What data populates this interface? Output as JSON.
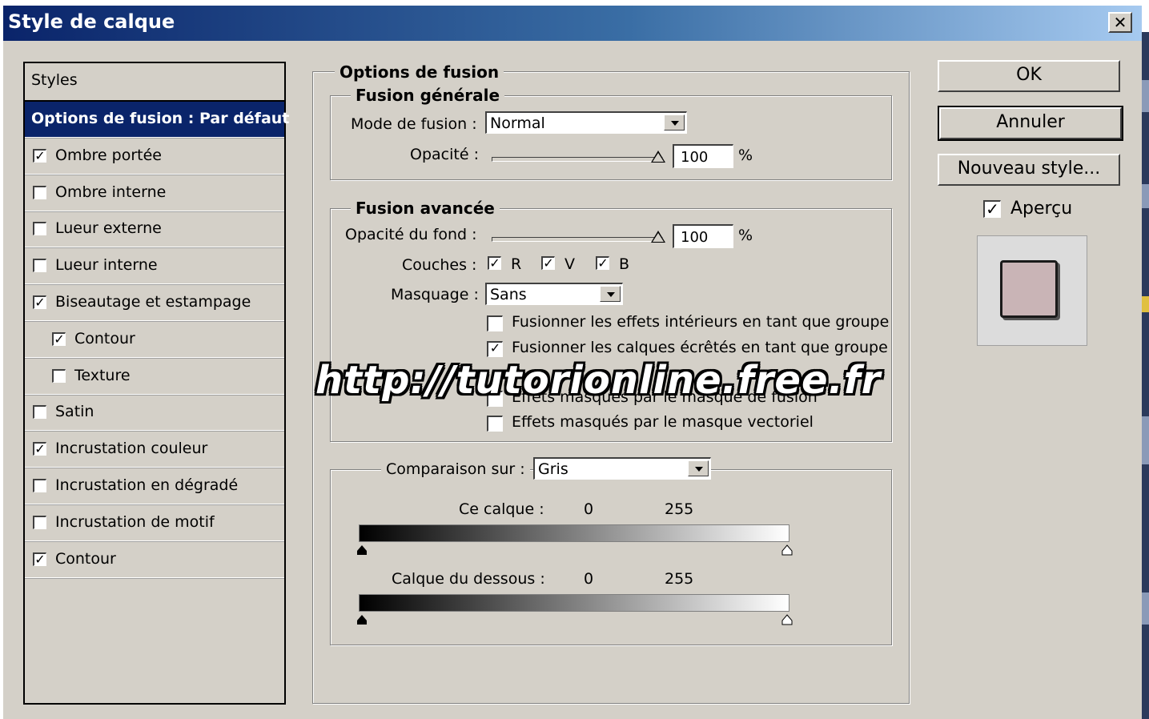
{
  "window": {
    "title": "Style de calque",
    "close_glyph": "✕"
  },
  "styles_list": {
    "header": "Styles",
    "items": [
      {
        "label": "Options de fusion : Par défaut",
        "selected": true,
        "has_checkbox": false,
        "checked": false,
        "indent": false
      },
      {
        "label": "Ombre portée",
        "selected": false,
        "has_checkbox": true,
        "checked": true,
        "indent": false
      },
      {
        "label": "Ombre interne",
        "selected": false,
        "has_checkbox": true,
        "checked": false,
        "indent": false
      },
      {
        "label": "Lueur externe",
        "selected": false,
        "has_checkbox": true,
        "checked": false,
        "indent": false
      },
      {
        "label": "Lueur interne",
        "selected": false,
        "has_checkbox": true,
        "checked": false,
        "indent": false
      },
      {
        "label": "Biseautage et estampage",
        "selected": false,
        "has_checkbox": true,
        "checked": true,
        "indent": false
      },
      {
        "label": "Contour",
        "selected": false,
        "has_checkbox": true,
        "checked": true,
        "indent": true
      },
      {
        "label": "Texture",
        "selected": false,
        "has_checkbox": true,
        "checked": false,
        "indent": true
      },
      {
        "label": "Satin",
        "selected": false,
        "has_checkbox": true,
        "checked": false,
        "indent": false
      },
      {
        "label": "Incrustation couleur",
        "selected": false,
        "has_checkbox": true,
        "checked": true,
        "indent": false
      },
      {
        "label": "Incrustation en dégradé",
        "selected": false,
        "has_checkbox": true,
        "checked": false,
        "indent": false
      },
      {
        "label": "Incrustation de motif",
        "selected": false,
        "has_checkbox": true,
        "checked": false,
        "indent": false
      },
      {
        "label": "Contour",
        "selected": false,
        "has_checkbox": true,
        "checked": true,
        "indent": false
      }
    ]
  },
  "blend_options": {
    "title": "Options de fusion",
    "general": {
      "title": "Fusion générale",
      "mode_label": "Mode de fusion :",
      "mode_value": "Normal",
      "opacity_label": "Opacité :",
      "opacity_value": "100",
      "opacity_unit": "%",
      "opacity_level": 1.0
    },
    "advanced": {
      "title": "Fusion avancée",
      "fill_label": "Opacité du fond :",
      "fill_value": "100",
      "fill_unit": "%",
      "fill_level": 1.0,
      "channels_label": "Couches :",
      "channels": [
        {
          "label": "R",
          "checked": true
        },
        {
          "label": "V",
          "checked": true
        },
        {
          "label": "B",
          "checked": true
        }
      ],
      "knockout_label": "Masquage :",
      "knockout_value": "Sans",
      "options": [
        {
          "label": "Fusionner les effets intérieurs en tant que groupe",
          "checked": false
        },
        {
          "label": "Fusionner les calques écrêtés en tant que groupe",
          "checked": true
        },
        {
          "label": "Effets masqués par le masque de fusion",
          "checked": false
        },
        {
          "label": "Effets masqués par le masque vectoriel",
          "checked": false
        }
      ]
    },
    "blend_if": {
      "label": "Comparaison sur :",
      "value": "Gris",
      "this_layer": {
        "label": "Ce calque :",
        "min": "0",
        "max": "255"
      },
      "underlying": {
        "label": "Calque du dessous :",
        "min": "0",
        "max": "255"
      }
    }
  },
  "buttons": {
    "ok": "OK",
    "cancel": "Annuler",
    "new_style": "Nouveau style...",
    "preview_label": "Aperçu",
    "preview_checked": true
  },
  "watermark": "http://tutorionline.free.fr",
  "colors": {
    "title_start": "#0a246a",
    "title_end": "#a6caf0",
    "dialog_bg": "#d4d0c8",
    "selection": "#0a246a",
    "swatch": "#c9b4b6"
  }
}
